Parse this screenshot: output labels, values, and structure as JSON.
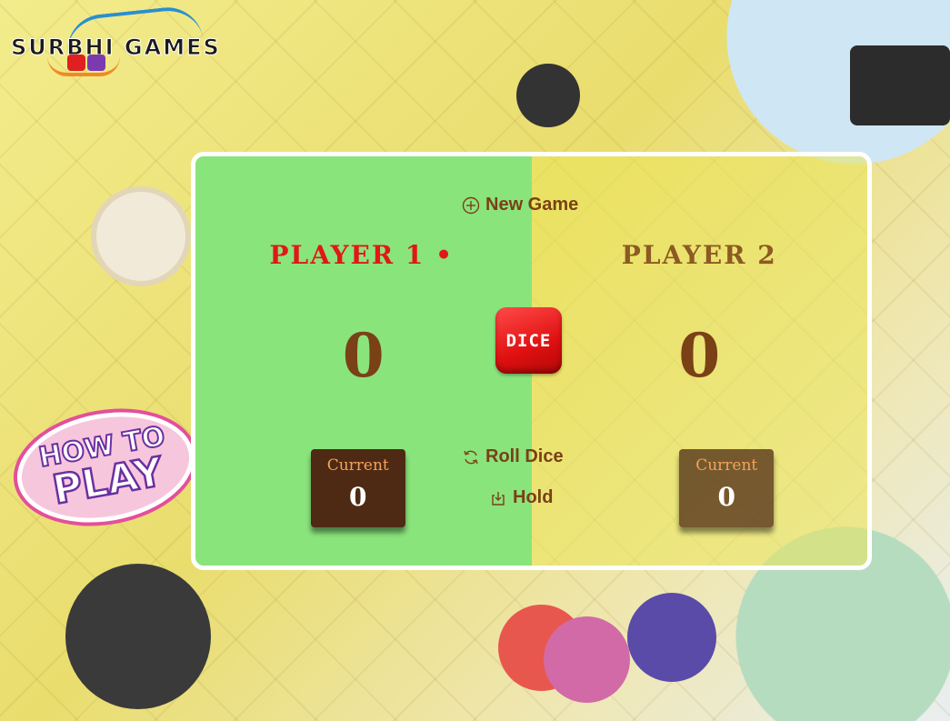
{
  "logo": {
    "text": "SURBHI GAMES"
  },
  "how_to_play": {
    "line1": "HOW TO",
    "line2": "PLAY"
  },
  "controls": {
    "new_game": "New Game",
    "roll_dice": "Roll Dice",
    "hold": "Hold",
    "dice_label": "DICE"
  },
  "players": [
    {
      "name": "PLAYER 1",
      "active_marker": "•",
      "score": "0",
      "current_label": "Current",
      "current_value": "0"
    },
    {
      "name": "PLAYER 2",
      "score": "0",
      "current_label": "Current",
      "current_value": "0"
    }
  ],
  "colors": {
    "player1_panel": "#8ae47c",
    "player2_panel": "#ebe65a",
    "active_name": "#e01818",
    "inactive_name": "#8c5a22",
    "score": "#7a4016",
    "current_box": "#4e2a14",
    "dice": "#e01010"
  }
}
